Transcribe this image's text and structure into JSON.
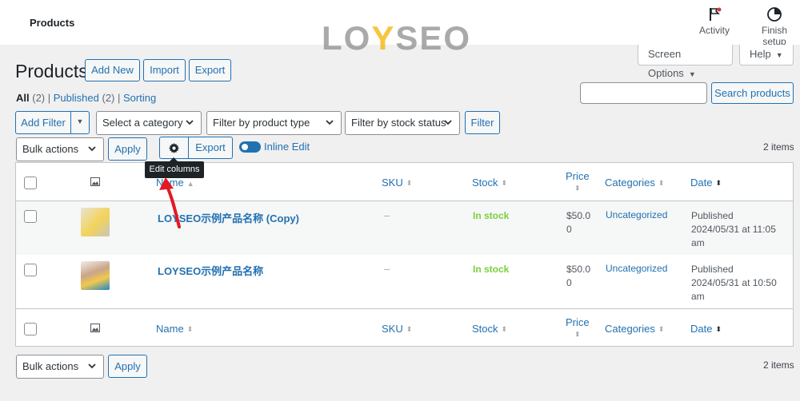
{
  "topbar": {
    "title": "Products",
    "watermark": {
      "part1": "LO",
      "part2": "Y",
      "part3": "SEO"
    },
    "activity_label": "Activity",
    "finish_label": "Finish setup"
  },
  "screen_options_label": "Screen Options",
  "help_label": "Help",
  "page_title": "Products",
  "header_buttons": {
    "add_new": "Add New",
    "import": "Import",
    "export": "Export"
  },
  "views": {
    "all_label": "All",
    "all_count": "(2)",
    "published_label": "Published",
    "published_count": "(2)",
    "sorting_label": "Sorting"
  },
  "search": {
    "placeholder": "",
    "button": "Search products"
  },
  "filters": {
    "add_filter": "Add Filter",
    "category": "Select a category",
    "product_type": "Filter by product type",
    "stock_status": "Filter by stock status",
    "filter_button": "Filter"
  },
  "bulk": {
    "label": "Bulk actions",
    "apply": "Apply",
    "export": "Export",
    "inline_edit": "Inline Edit"
  },
  "items_count": "2 items",
  "tooltip": "Edit columns",
  "columns": {
    "name": "Name",
    "sku": "SKU",
    "stock": "Stock",
    "price_line1": "Price",
    "categories": "Categories",
    "date": "Date"
  },
  "rows": [
    {
      "name": "LOYSEO示例产品名称 (Copy)",
      "sku": "–",
      "stock": "In stock",
      "price_line1": "$50.0",
      "price_line2": "0",
      "category": "Uncategorized",
      "status": "Published",
      "date_line1": "2024/05/31 at 11:05",
      "date_line2": "am"
    },
    {
      "name": "LOYSEO示例产品名称",
      "sku": "–",
      "stock": "In stock",
      "price_line1": "$50.0",
      "price_line2": "0",
      "category": "Uncategorized",
      "status": "Published",
      "date_line1": "2024/05/31 at 10:50",
      "date_line2": "am"
    }
  ],
  "colors": {
    "accent": "#2271b1",
    "in_stock": "#7ad03a",
    "arrow": "#e01b24"
  }
}
